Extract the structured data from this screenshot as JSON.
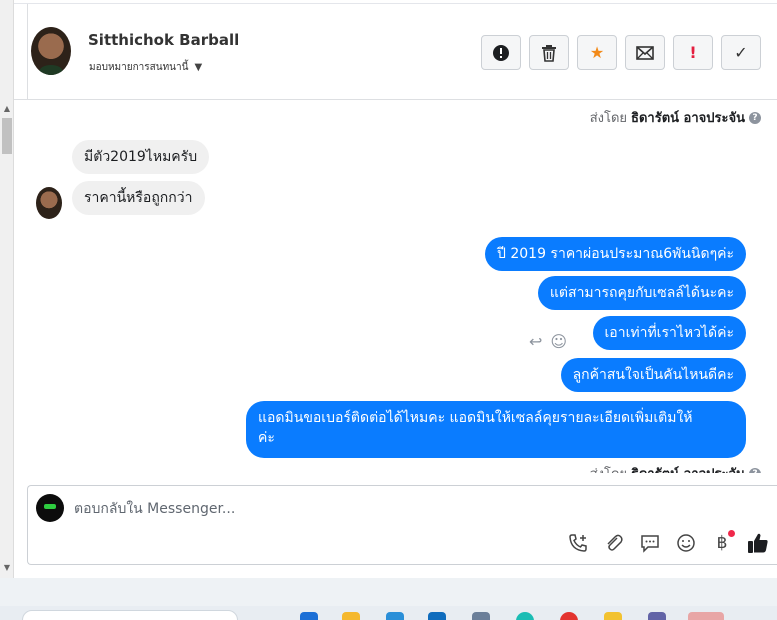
{
  "header": {
    "name": "Sitthichok Barball",
    "assign_label": "มอบหมายการสนทนานี้",
    "actions": [
      {
        "name": "report",
        "icon": "exclamation-circle-icon"
      },
      {
        "name": "delete",
        "icon": "trash-icon"
      },
      {
        "name": "star",
        "icon": "star-icon"
      },
      {
        "name": "mark-unread",
        "icon": "envelope-icon"
      },
      {
        "name": "mark-important",
        "icon": "exclamation-icon"
      },
      {
        "name": "done",
        "icon": "check-icon"
      }
    ]
  },
  "chat": {
    "sent_by_prefix": "ส่งโดย",
    "sent_by_name": "ธิดารัตน์ อาจประจัน",
    "incoming": [
      "มีตัว2019ไหมครับ",
      "ราคานี้หรือถูกกว่า"
    ],
    "outgoing": [
      "ปี 2019 ราคาผ่อนประมาณ6พันนิดๆค่ะ",
      "แต่สามารถคุยกับเซลล์ได้นะคะ",
      "เอาเท่าที่เราไหวได้ค่ะ",
      "ลูกค้าสนใจเป็นคันไหนดีคะ",
      "แอดมินขอเบอร์ติดต่อได้ไหมคะ แอดมินให้เซลล์คุยรายละเอียดเพิ่มเติมให้",
      "ค่ะ"
    ]
  },
  "composer": {
    "placeholder": "ตอบกลับใน Messenger..."
  },
  "colors": {
    "outgoing_bubble": "#0a7cff",
    "incoming_bubble": "#f0f0f0",
    "star": "#f28a1a",
    "important": "#e41e3f"
  }
}
